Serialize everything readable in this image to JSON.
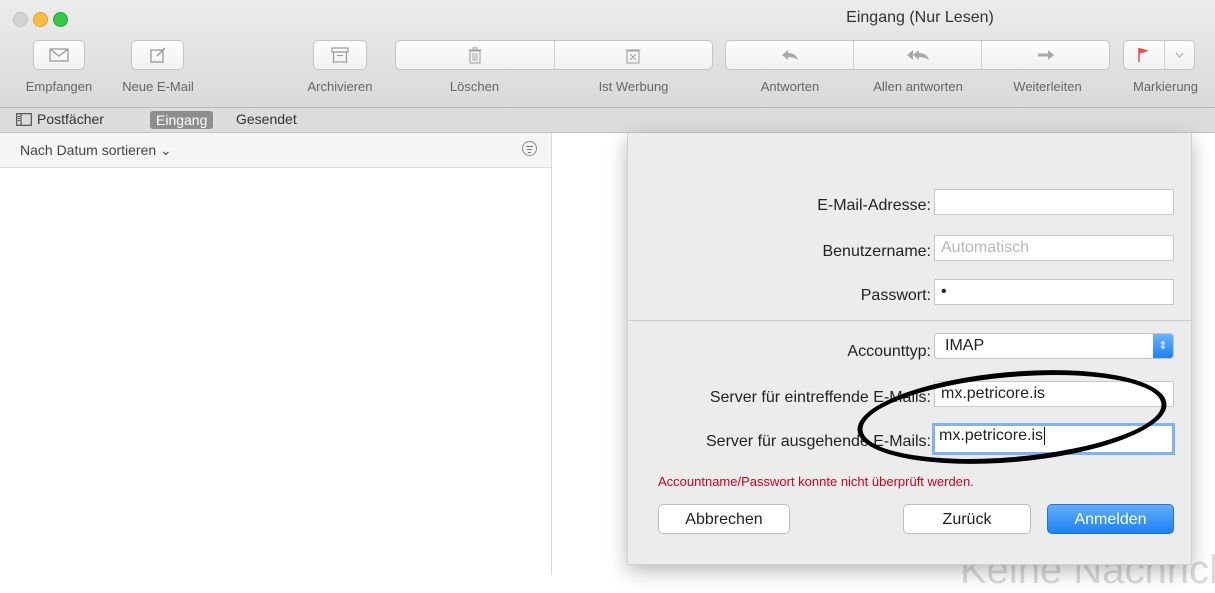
{
  "window": {
    "title": "Eingang (Nur Lesen)"
  },
  "toolbar": {
    "get_mail": "Empfangen",
    "new_mail": "Neue E-Mail",
    "archive": "Archivieren",
    "delete": "Löschen",
    "junk": "Ist Werbung",
    "reply": "Antworten",
    "reply_all": "Allen antworten",
    "forward": "Weiterleiten",
    "flag": "Markierung",
    "flag_color": "#f0474e"
  },
  "tabs": {
    "mailboxes": "Postfächer",
    "inbox": "Eingang",
    "sent": "Gesendet"
  },
  "list": {
    "sort_label": "Nach Datum sortieren ⌄"
  },
  "viewer": {
    "empty_text": "Keine Nachricht"
  },
  "dialog": {
    "email_label": "E-Mail-Adresse:",
    "email_value": "",
    "username_label": "Benutzername:",
    "username_placeholder": "Automatisch",
    "password_label": "Passwort:",
    "password_value": "•",
    "account_type_label": "Accounttyp:",
    "account_type_value": "IMAP",
    "incoming_label": "Server für eintreffende E-Mails:",
    "incoming_value": "mx.petricore.is",
    "outgoing_label": "Server für ausgehende E-Mails:",
    "outgoing_value": "mx.petricore.is",
    "error": "Accountname/Passwort konnte nicht überprüft werden.",
    "cancel": "Abbrechen",
    "back": "Zurück",
    "sign_in": "Anmelden"
  },
  "colors": {
    "accent": "#1d83f6",
    "error": "#d0021b"
  }
}
